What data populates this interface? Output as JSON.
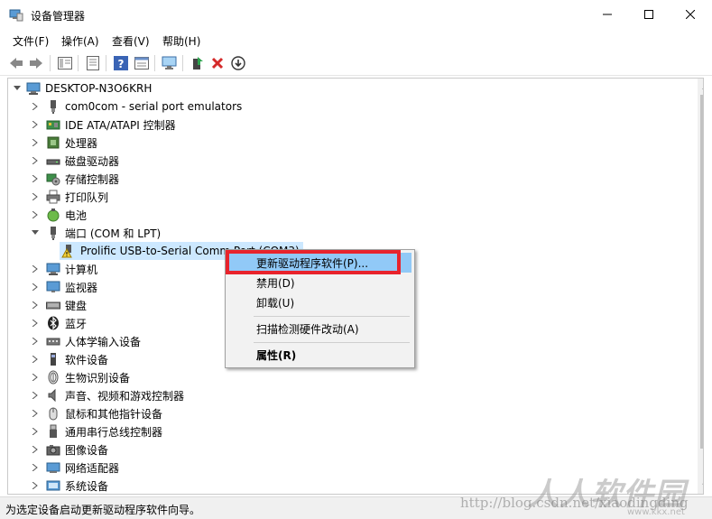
{
  "window": {
    "title": "设备管理器",
    "icon": "device-manager-icon"
  },
  "menu": [
    "文件(F)",
    "操作(A)",
    "查看(V)",
    "帮助(H)"
  ],
  "toolbar_icons": [
    "back-arrow-icon",
    "forward-arrow-icon",
    "show-hide-tree-icon",
    "properties-icon",
    "help-icon",
    "action-pane-icon",
    "scan-monitor-icon",
    "update-driver-icon",
    "uninstall-x-icon",
    "disable-device-icon"
  ],
  "tree": {
    "root": "DESKTOP-N3O6KRH",
    "items": [
      {
        "label": "com0com - serial port emulators",
        "icon": "serial-port-icon",
        "expanded": false
      },
      {
        "label": "IDE ATA/ATAPI 控制器",
        "icon": "ide-controller-icon",
        "expanded": false
      },
      {
        "label": "处理器",
        "icon": "processor-icon",
        "expanded": false
      },
      {
        "label": "磁盘驱动器",
        "icon": "disk-drive-icon",
        "expanded": false
      },
      {
        "label": "存储控制器",
        "icon": "storage-controller-icon",
        "expanded": false
      },
      {
        "label": "打印队列",
        "icon": "printer-icon",
        "expanded": false
      },
      {
        "label": "电池",
        "icon": "battery-icon",
        "expanded": false
      },
      {
        "label": "端口 (COM 和 LPT)",
        "icon": "port-icon",
        "expanded": true
      },
      {
        "label": "Prolific USB-to-Serial Comm Port (COM3)",
        "icon": "warning-icon",
        "child": true
      },
      {
        "label": "计算机",
        "icon": "computer-icon",
        "expanded": false
      },
      {
        "label": "监视器",
        "icon": "monitor-icon",
        "expanded": false
      },
      {
        "label": "键盘",
        "icon": "keyboard-icon",
        "expanded": false
      },
      {
        "label": "蓝牙",
        "icon": "bluetooth-icon",
        "expanded": false
      },
      {
        "label": "人体学输入设备",
        "icon": "hid-icon",
        "expanded": false
      },
      {
        "label": "软件设备",
        "icon": "software-device-icon",
        "expanded": false
      },
      {
        "label": "生物识别设备",
        "icon": "biometric-icon",
        "expanded": false
      },
      {
        "label": "声音、视频和游戏控制器",
        "icon": "sound-icon",
        "expanded": false
      },
      {
        "label": "鼠标和其他指针设备",
        "icon": "mouse-icon",
        "expanded": false
      },
      {
        "label": "通用串行总线控制器",
        "icon": "usb-icon",
        "expanded": false
      },
      {
        "label": "图像设备",
        "icon": "imaging-icon",
        "expanded": false
      },
      {
        "label": "网络适配器",
        "icon": "network-adapter-icon",
        "expanded": false
      },
      {
        "label": "系统设备",
        "icon": "system-device-icon",
        "expanded": false
      }
    ]
  },
  "context_menu": {
    "update_driver": "更新驱动程序软件(P)...",
    "disable": "禁用(D)",
    "uninstall": "卸载(U)",
    "scan": "扫描检测硬件改动(A)",
    "properties": "属性(R)"
  },
  "status": "为选定设备启动更新驱动程序软件向导。",
  "watermark": {
    "url": "http://blog.csdn.net/xiaodingding",
    "site_name": "人人软件园",
    "site_url": "www.kkx.net"
  },
  "colors": {
    "highlight": "#91c9f7",
    "red_box": "#e8232c",
    "selection": "#cce8ff"
  }
}
